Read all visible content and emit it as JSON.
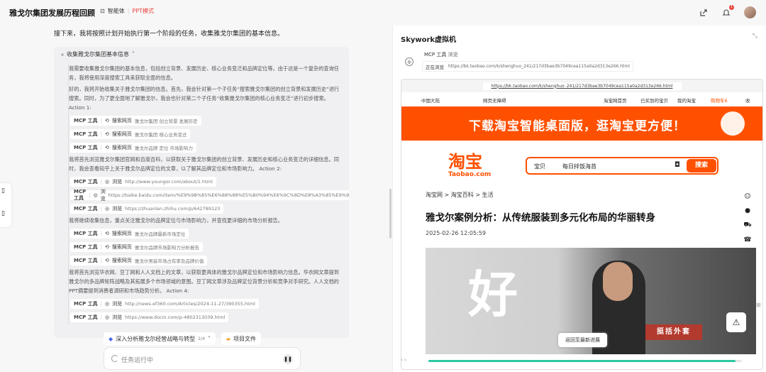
{
  "app": {
    "title": "雅戈尔集团发展历程回顾",
    "agent_label": "智能体",
    "mode_label": "PPT模式",
    "notif_count": "1"
  },
  "chat": {
    "intro": "接下来，我将按照计划开始执行第一个阶段的任务，收集雅戈尔集团的基本信息。",
    "think_header": "收集雅戈尔集团基本信息",
    "blocks": [
      {
        "type": "text",
        "text": "我需要收集雅戈尔集团的基本信息，包括创立背景、发展历史、核心业务变迁和品牌定位等。由于这是一个复杂的查询任务，我将使用深度搜索工具来获取全面的信息。"
      },
      {
        "type": "text",
        "text": "好的，我将开始收集关于雅戈尔集团的信息。首先，我会针对第一个子任务“搜索雅戈尔集团的创立背景和发展历史”进行搜索。同时，为了更全面地了解雅戈尔，我会也针对第二个子任务“收集雅戈尔集团的核心业务变迁”进行初步搜索。 Action 1:"
      },
      {
        "type": "tool",
        "tool": "MCP 工具",
        "action": "搜索网页",
        "query": "雅戈尔集团 创立背景 发展历史"
      },
      {
        "type": "tool",
        "tool": "MCP 工具",
        "action": "搜索网页",
        "query": "雅戈尔集团 核心业务变迁"
      },
      {
        "type": "tool",
        "tool": "MCP 工具",
        "action": "搜索网页",
        "query": "雅戈尔品牌 定位 市场影响力"
      },
      {
        "type": "text",
        "text": "我将首先浏览雅戈尔集团官网和百度百科，以获取关于雅戈尔集团的创立背景、发展历史和核心业务变迁的详细信息。同时，我会查看知乎上关于雅戈尔品牌定位的文章，以了解其品牌定位和市场影响力。 Action 2:"
      },
      {
        "type": "tool",
        "tool": "MCP 工具",
        "action": "浏览",
        "query": "http://www.youngor.com/about/1.html"
      },
      {
        "type": "tool",
        "tool": "MCP 工具",
        "action": "浏览",
        "query": "https://baike.baidu.com/item/%E9%9B%85%E6%88%88%E5%B0%94%E6%9C%8D%E8%A3%85%E9%9B%86%E5%9B%A2..."
      },
      {
        "type": "tool",
        "tool": "MCP 工具",
        "action": "浏览",
        "query": "https://zhuanlan.zhihu.com/p/642789123"
      },
      {
        "type": "text",
        "text": "我将继续收集信息，重点关注雅戈尔的品牌定位与市场影响力，并查找更详细的市场分析报告。"
      },
      {
        "type": "tool",
        "tool": "MCP 工具",
        "action": "搜索网页",
        "query": "雅戈尔品牌最新市场定位"
      },
      {
        "type": "tool",
        "tool": "MCP 工具",
        "action": "搜索网页",
        "query": "雅戈尔品牌市场影响力分析报告"
      },
      {
        "type": "tool",
        "tool": "MCP 工具",
        "action": "搜索网页",
        "query": "雅戈尔男装市场占有率及品牌价值"
      },
      {
        "type": "text",
        "text": "我将首先浏览华衣网、豆丁网和人人文档上的文章，以获取更具体的雅戈尔品牌定位和市场影响力信息。华衣网文章提到雅戈尔的多品牌矩阵战略及其拓展多个市场领域的意图。豆丁网文章涉及品牌定位背景分析和竞争对手研究。人人文档的PPT摘要提到消费者调研和市场趋势分析。 Action 4:"
      },
      {
        "type": "tool",
        "tool": "MCP 工具",
        "action": "浏览",
        "query": "http://news.ef360.com/Articles/2024-11-27/390355.html"
      },
      {
        "type": "tool",
        "tool": "MCP 工具",
        "action": "浏览",
        "query": "https://www.docin.com/p-4802313039.html"
      }
    ],
    "task_tab": {
      "label": "深入分析雅戈尔经营战略与转型",
      "count": "2/4"
    },
    "files_tab": "项目文件",
    "input_placeholder": "任务运行中"
  },
  "vm": {
    "title": "Skywork虚拟机",
    "mcp_label": "MCP 工具",
    "mcp_action": "浏览",
    "visiting_label": "正在浏览",
    "visiting_url": "https://bk.taobao.com/k/shenghuo_241/217d3bae3b7049cea115a0a2d313e266.html",
    "browser_url": "https://bk.taobao.com/k/shenghuo_241/217d3bae3b7049cea115a0a2d313e266.html",
    "progress": 0.98
  },
  "taobao": {
    "nav": {
      "region": "中国大陆",
      "accessibility": "网页无障碍",
      "home": "淘宝网首页",
      "bought": "已买到的宝贝",
      "my": "我的淘宝",
      "cart": "购物车6",
      "fav": "收"
    },
    "banner": "下载淘宝智能桌面版，逛淘宝更方便！",
    "logo_cn": "淘宝",
    "logo_en": "Taobao.com",
    "search_cat": "宝贝",
    "search_value": "每日拌饭海苔",
    "search_btn": "搜索",
    "breadcrumb": "淘宝网 > 淘宝百科 > 生活",
    "article_title": "雅戈尔案例分析：从传统服装到多元化布局的华丽转身",
    "article_date": "2025-02-26 12:05:59",
    "photo_text": "好",
    "photo_label": "挺括外套",
    "back_btn": "返回至最新进展"
  }
}
